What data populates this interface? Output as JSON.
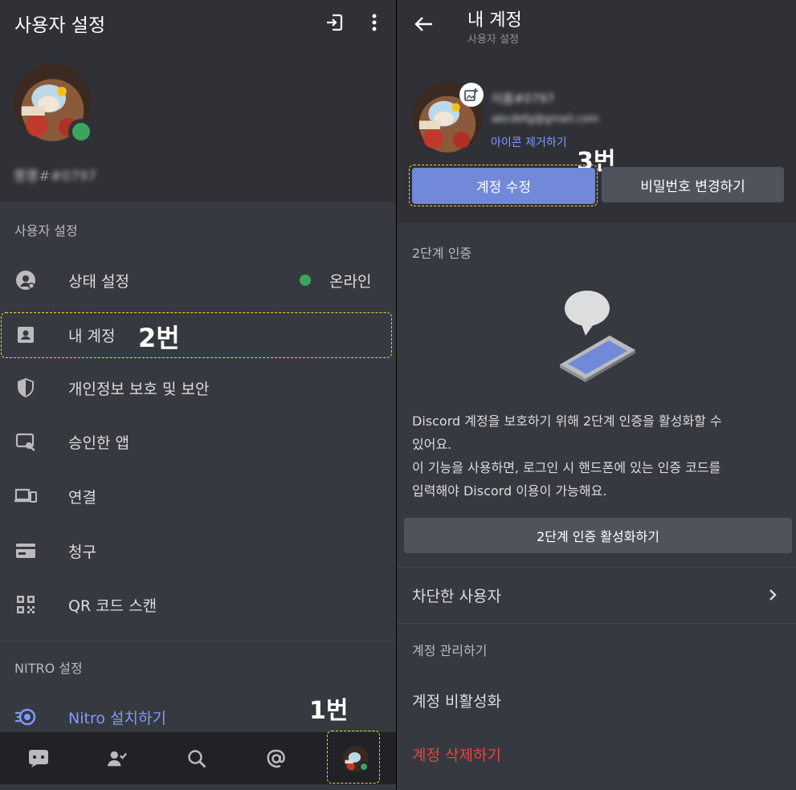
{
  "left": {
    "title": "사용자 설정",
    "username_blur": "뽕뽕",
    "tag_blur": "#0797",
    "section_user": "사용자 설정",
    "items": [
      {
        "label": "상태 설정",
        "status": "온라인"
      },
      {
        "label": "내 계정"
      },
      {
        "label": "개인정보 보호 및 보안"
      },
      {
        "label": "승인한 앱"
      },
      {
        "label": "연결"
      },
      {
        "label": "청구"
      },
      {
        "label": "QR 코드 스캔"
      }
    ],
    "section_nitro": "NITRO 설정",
    "nitro_item": "Nitro 설치하기",
    "annotation_2": "2번",
    "annotation_1": "1번"
  },
  "right": {
    "title": "내 계정",
    "subtitle": "사용자 설정",
    "name_blur": "이름#0797",
    "email_blur": "abcdefg@gmail.com",
    "remove_icon": "아이콘 제거하기",
    "annotation_3": "3번",
    "edit_button": "계정 수정",
    "password_button": "비밀번호 변경하기",
    "twofa_head": "2단계 인증",
    "twofa_desc_1": "Discord 계정을 보호하기 위해 2단계 인증을 활성화할 수",
    "twofa_desc_2": "있어요.",
    "twofa_desc_3": "이 기능을 사용하면, 로그인 시 핸드폰에 있는 인증 코드를",
    "twofa_desc_4": "입력해야 Discord 이용이 가능해요.",
    "twofa_button": "2단계 인증 활성화하기",
    "blocked_users": "차단한 사용자",
    "manage_head": "계정 관리하기",
    "deactivate": "계정 비활성화",
    "delete": "계정 삭제하기"
  },
  "colors": {
    "online": "#3ba55d",
    "blurple": "#7289da",
    "link": "#7c9bff",
    "danger": "#ed4245",
    "annotation": "#f5d33b"
  },
  "icons": [
    "logout-icon",
    "more-vertical-icon",
    "status-icon",
    "account-card-icon",
    "shield-icon",
    "authorized-apps-icon",
    "devices-icon",
    "billing-card-icon",
    "qr-icon",
    "nitro-icon",
    "chat-icon",
    "friends-icon",
    "search-icon",
    "mention-icon",
    "back-arrow-icon",
    "add-image-icon",
    "chevron-right-icon"
  ]
}
